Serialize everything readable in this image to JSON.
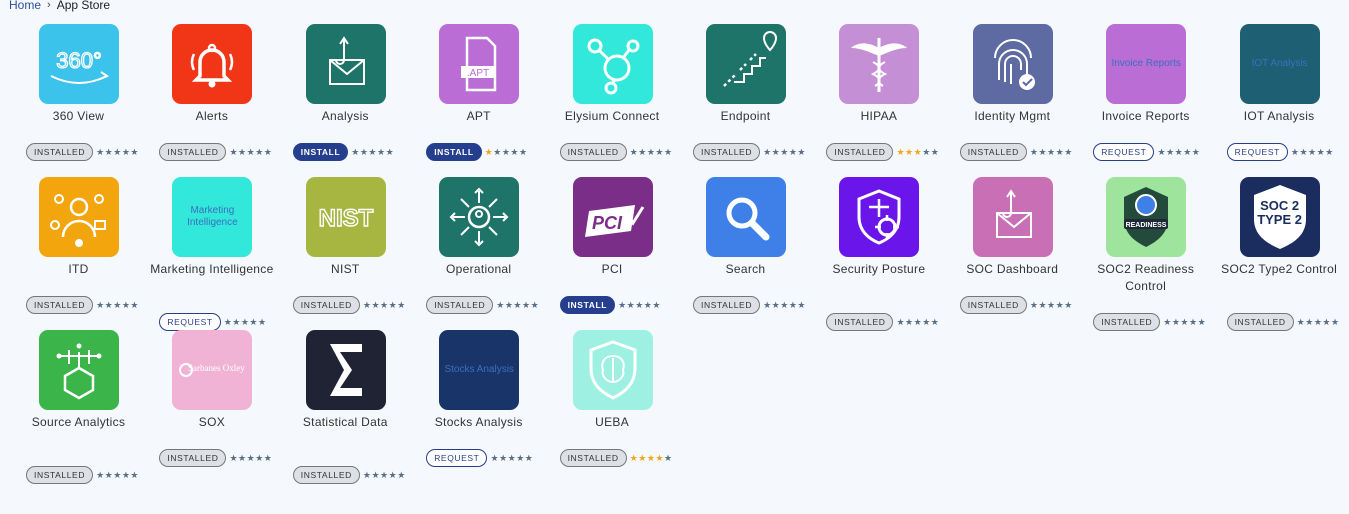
{
  "breadcrumb": {
    "home": "Home",
    "separator": "›",
    "current": "App Store"
  },
  "apps": [
    {
      "name": "360 View",
      "status": "INSTALLED",
      "rating": 0,
      "icon": "360-icon",
      "bg": "#3cc3ec"
    },
    {
      "name": "Alerts",
      "status": "INSTALLED",
      "rating": 0,
      "icon": "bell-icon",
      "bg": "#f13617"
    },
    {
      "name": "Analysis",
      "status": "INSTALL",
      "rating": 0,
      "icon": "envelope-hook-icon",
      "bg": "#1e7468"
    },
    {
      "name": "APT",
      "status": "INSTALL",
      "rating": 1,
      "icon": "apt-file-icon",
      "bg": "#b96dd5"
    },
    {
      "name": "Elysium Connect",
      "status": "INSTALLED",
      "rating": 0,
      "icon": "connect-icon",
      "bg": "#31e8da"
    },
    {
      "name": "Endpoint",
      "status": "INSTALLED",
      "rating": 0,
      "icon": "endpoint-icon",
      "bg": "#1e7468"
    },
    {
      "name": "HIPAA",
      "status": "INSTALLED",
      "rating": 3,
      "icon": "caduceus-icon",
      "bg": "#c58fd6"
    },
    {
      "name": "Identity Mgmt",
      "status": "INSTALLED",
      "rating": 0,
      "icon": "fingerprint-icon",
      "bg": "#5e6aa2"
    },
    {
      "name": "Invoice Reports",
      "status": "REQUEST",
      "rating": 0,
      "icon": "invoice-reports-image",
      "bg": "#b96dd5",
      "alt": "Invoice Reports"
    },
    {
      "name": "IOT Analysis",
      "status": "REQUEST",
      "rating": 0,
      "icon": "iot-analysis-image",
      "bg": "#1e5f73",
      "alt": "IOT Analysis"
    },
    {
      "name": "ITD",
      "status": "INSTALLED",
      "rating": 0,
      "icon": "itd-icon",
      "bg": "#f3a50e"
    },
    {
      "name": "Marketing Intelligence",
      "status": "REQUEST",
      "rating": 0,
      "icon": "marketing-image",
      "bg": "#31e8da",
      "alt": "Marketing Intelligence"
    },
    {
      "name": "NIST",
      "status": "INSTALLED",
      "rating": 0,
      "icon": "nist-icon",
      "bg": "#a6b640"
    },
    {
      "name": "Operational",
      "status": "INSTALLED",
      "rating": 0,
      "icon": "operational-icon",
      "bg": "#1e7468"
    },
    {
      "name": "PCI",
      "status": "INSTALL",
      "rating": 0,
      "icon": "pci-icon",
      "bg": "#7a2e87"
    },
    {
      "name": "Search",
      "status": "INSTALLED",
      "rating": 0,
      "icon": "search-icon",
      "bg": "#3f7fe8"
    },
    {
      "name": "Security Posture",
      "status": "INSTALLED",
      "rating": 0,
      "icon": "shield-target-icon",
      "bg": "#6a16ea"
    },
    {
      "name": "SOC Dashboard",
      "status": "INSTALLED",
      "rating": 0,
      "icon": "envelope-hook-icon",
      "bg": "#c86fb5"
    },
    {
      "name": "SOC2 Readiness Control",
      "status": "INSTALLED",
      "rating": 0,
      "icon": "soc2-readiness-icon",
      "bg": "#9ee49c"
    },
    {
      "name": "SOC2 Type2 Control",
      "status": "INSTALLED",
      "rating": 0,
      "icon": "soc2-type2-icon",
      "bg": "#1a2d5e",
      "badge_lines": [
        "SOC 2",
        "TYPE 2"
      ]
    },
    {
      "name": "Source Analytics",
      "status": "INSTALLED",
      "rating": 0,
      "icon": "source-analytics-icon",
      "bg": "#3bb54a"
    },
    {
      "name": "SOX",
      "status": "INSTALLED",
      "rating": 0,
      "icon": "sox-icon",
      "bg": "#f0b3d6",
      "logo_text": "Sarbanes Oxley"
    },
    {
      "name": "Statistical Data",
      "status": "INSTALLED",
      "rating": 0,
      "icon": "sigma-icon",
      "bg": "#1f2333"
    },
    {
      "name": "Stocks Analysis",
      "status": "REQUEST",
      "rating": 0,
      "icon": "stocks-analysis-image",
      "bg": "#183468",
      "alt": "Stocks Analysis"
    },
    {
      "name": "UEBA",
      "status": "INSTALLED",
      "rating": 4,
      "icon": "brain-shield-icon",
      "bg": "#9ef0e2"
    }
  ]
}
